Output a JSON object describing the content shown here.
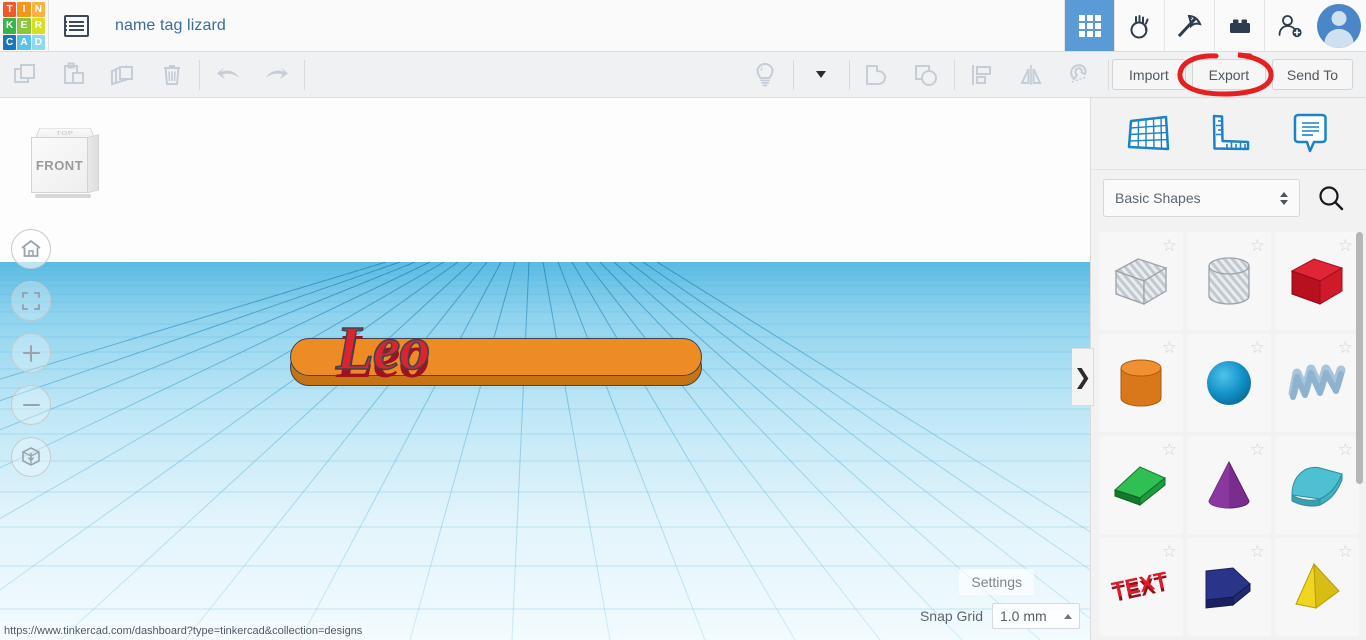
{
  "header": {
    "logo": {
      "name": "tinkercad-logo",
      "cells": [
        {
          "letter": "T",
          "color": "#f05a28"
        },
        {
          "letter": "I",
          "color": "#f7941e"
        },
        {
          "letter": "N",
          "color": "#fbb040"
        },
        {
          "letter": "K",
          "color": "#39b54a"
        },
        {
          "letter": "E",
          "color": "#8cc63f"
        },
        {
          "letter": "R",
          "color": "#d7df23"
        },
        {
          "letter": "C",
          "color": "#1c75bc"
        },
        {
          "letter": "A",
          "color": "#5bc2e7"
        },
        {
          "letter": "D",
          "color": "#8fd8f2"
        }
      ]
    },
    "doc_menu_icon": "list-menu-icon",
    "title": "name tag lizard",
    "icons": [
      {
        "name": "designs-grid-icon",
        "active": true
      },
      {
        "name": "codeblocks-icon",
        "active": false
      },
      {
        "name": "pickaxe-minecraft-icon",
        "active": false
      },
      {
        "name": "lego-brick-icon",
        "active": false
      },
      {
        "name": "add-person-icon",
        "active": false
      }
    ],
    "avatar": "user-avatar"
  },
  "toolbar": {
    "left_tools": [
      {
        "name": "copy-button",
        "icon": "copy-icon"
      },
      {
        "name": "paste-button",
        "icon": "clipboard-paste-icon"
      },
      {
        "name": "duplicate-button",
        "icon": "duplicate-icon"
      },
      {
        "name": "delete-button",
        "icon": "trash-icon"
      }
    ],
    "history_tools": [
      {
        "name": "undo-button",
        "icon": "undo-arrow-icon"
      },
      {
        "name": "redo-button",
        "icon": "redo-arrow-icon"
      }
    ],
    "mid_tools": [
      {
        "name": "lightbulb-button",
        "icon": "lightbulb-icon"
      },
      {
        "name": "lightbulb-dropdown",
        "icon": "chevron-down-icon"
      },
      {
        "name": "group-button",
        "icon": "group-shapes-icon"
      },
      {
        "name": "ungroup-button",
        "icon": "ungroup-shapes-icon"
      },
      {
        "name": "align-button",
        "icon": "align-icon"
      },
      {
        "name": "mirror-button",
        "icon": "mirror-flip-icon"
      },
      {
        "name": "magnet-button",
        "icon": "magnet-snap-icon"
      }
    ],
    "import_label": "Import",
    "export_label": "Export",
    "send_to_label": "Send To"
  },
  "annotation": {
    "name": "export-highlight-circle",
    "color": "#e52020",
    "target": "Export"
  },
  "canvas": {
    "viewcube": {
      "front_label": "FRONT",
      "top_label": "TOP"
    },
    "nav_buttons": [
      {
        "name": "home-view-button",
        "icon": "home-icon"
      },
      {
        "name": "fit-to-view-button",
        "icon": "fit-frame-icon"
      },
      {
        "name": "zoom-in-button",
        "icon": "plus-icon"
      },
      {
        "name": "zoom-out-button",
        "icon": "minus-icon"
      },
      {
        "name": "perspective-toggle-button",
        "icon": "perspective-box-icon"
      }
    ],
    "object": {
      "name": "name-tag-model",
      "text": "Leo",
      "plate_color": "#ed8b24",
      "text_color": "#dc2430"
    },
    "settings_label": "Settings",
    "snap_grid_label": "Snap Grid",
    "snap_grid_value": "1.0 mm",
    "collapse_handle": "❯"
  },
  "statusbar": {
    "url": "https://www.tinkercad.com/dashboard?type=tinkercad&collection=designs"
  },
  "right_panel": {
    "tools": [
      {
        "name": "workplane-tool",
        "icon": "workplane-grid-icon"
      },
      {
        "name": "ruler-tool",
        "icon": "ruler-icon"
      },
      {
        "name": "notes-tool",
        "icon": "note-bubble-icon"
      }
    ],
    "category_label": "Basic Shapes",
    "search_icon": "search-icon",
    "shapes": [
      [
        {
          "name": "shape-box-hole",
          "kind": "box",
          "color": "#b9bfc6",
          "hole": true,
          "star": true
        },
        {
          "name": "shape-cylinder-hole",
          "kind": "cylinder",
          "color": "#b9bfc6",
          "hole": true,
          "star": true
        },
        {
          "name": "shape-box",
          "kind": "box",
          "color": "#cc1a2b",
          "hole": false,
          "star": true
        }
      ],
      [
        {
          "name": "shape-cylinder",
          "kind": "cylinder",
          "color": "#e07b1b",
          "hole": false,
          "star": true
        },
        {
          "name": "shape-sphere",
          "kind": "sphere",
          "color": "#0e9bd0",
          "hole": false,
          "star": true
        },
        {
          "name": "shape-scribble",
          "kind": "scribble",
          "color": "#a8c5dc",
          "hole": false,
          "star": true
        }
      ],
      [
        {
          "name": "shape-roof",
          "kind": "roof",
          "color": "#1e9e3e",
          "hole": false,
          "star": true
        },
        {
          "name": "shape-cone",
          "kind": "cone",
          "color": "#7b2d8e",
          "hole": false,
          "star": true
        },
        {
          "name": "shape-round-roof",
          "kind": "dome",
          "color": "#3fa8bd",
          "hole": false,
          "star": true
        }
      ],
      [
        {
          "name": "shape-text",
          "kind": "text",
          "color": "#cc1a2b",
          "label": "TEXT",
          "hole": false,
          "star": true
        },
        {
          "name": "shape-polygon",
          "kind": "polygon",
          "color": "#26307a",
          "hole": false,
          "star": true
        },
        {
          "name": "shape-pyramid",
          "kind": "pyramid",
          "color": "#e8c920",
          "hole": false,
          "star": true
        }
      ]
    ]
  }
}
